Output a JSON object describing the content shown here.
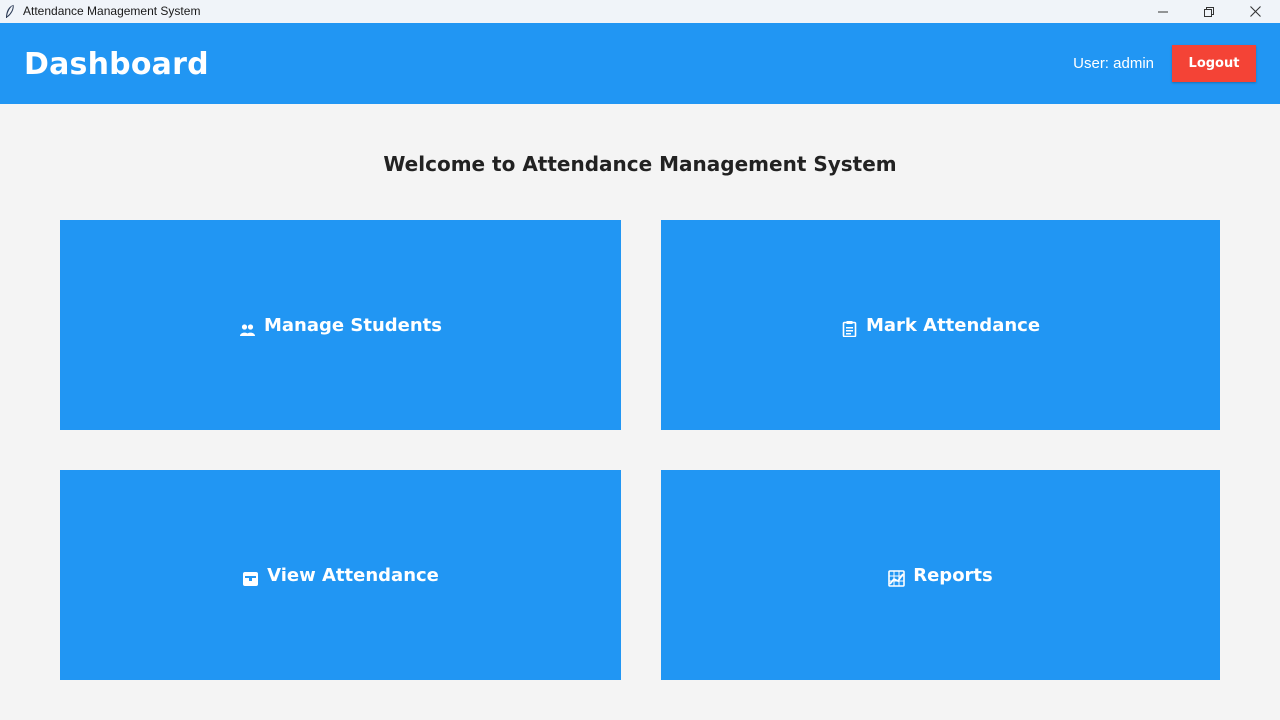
{
  "window": {
    "title": "Attendance Management System",
    "app_icon": "feather-icon",
    "controls": [
      "minimize-icon",
      "maximize-icon",
      "close-icon"
    ]
  },
  "header": {
    "title": "Dashboard",
    "user_label": "User: admin",
    "logout_label": "Logout"
  },
  "main": {
    "welcome": "Welcome to Attendance Management System",
    "tiles": [
      {
        "label": "Manage Students",
        "icon": "people-icon"
      },
      {
        "label": "Mark Attendance",
        "icon": "clipboard-icon"
      },
      {
        "label": "View Attendance",
        "icon": "calendar-icon"
      },
      {
        "label": "Reports",
        "icon": "chart-icon"
      }
    ]
  },
  "colors": {
    "accent": "#2196f3",
    "logout": "#f44336",
    "background": "#f4f4f4",
    "titlebar": "#f0f4f9"
  }
}
